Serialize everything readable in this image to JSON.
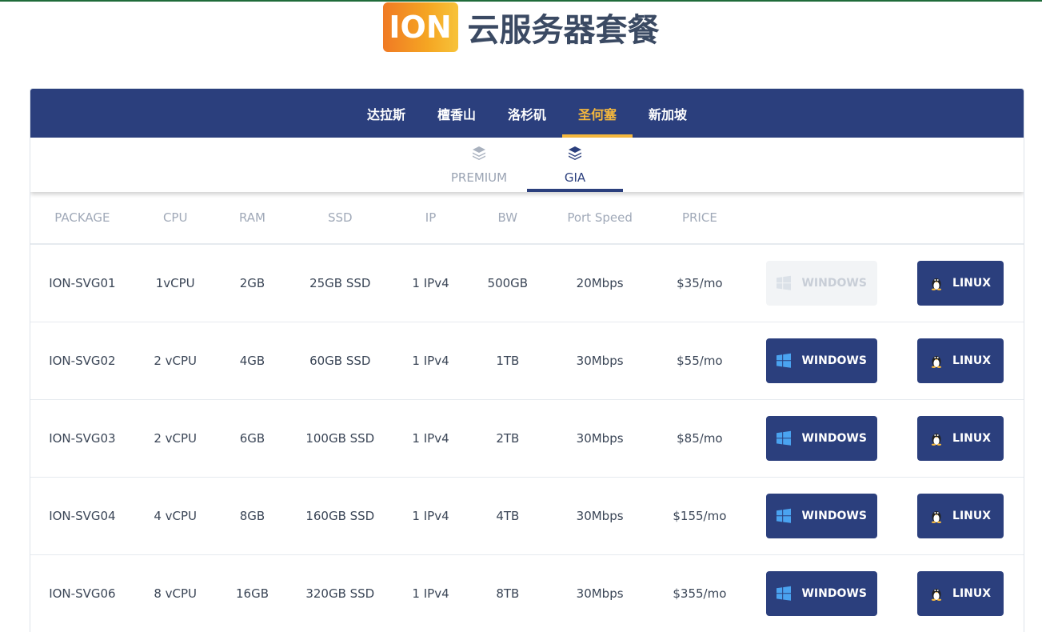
{
  "header": {
    "logo_text": "ION",
    "title": "云服务器套餐"
  },
  "locations": [
    {
      "label": "达拉斯",
      "active": false
    },
    {
      "label": "檀香山",
      "active": false
    },
    {
      "label": "洛杉矶",
      "active": false
    },
    {
      "label": "圣何塞",
      "active": true
    },
    {
      "label": "新加坡",
      "active": false
    }
  ],
  "plans": [
    {
      "label": "PREMIUM",
      "active": false
    },
    {
      "label": "GIA",
      "active": true
    }
  ],
  "table": {
    "headers": [
      "PACKAGE",
      "CPU",
      "RAM",
      "SSD",
      "IP",
      "BW",
      "Port Speed",
      "PRICE"
    ],
    "rows": [
      {
        "package": "ION-SVG01",
        "cpu": "1vCPU",
        "ram": "2GB",
        "ssd": "25GB SSD",
        "ip": "1 IPv4",
        "bw": "500GB",
        "port": "20Mbps",
        "price": "$35/mo",
        "windows_enabled": false
      },
      {
        "package": "ION-SVG02",
        "cpu": "2 vCPU",
        "ram": "4GB",
        "ssd": "60GB SSD",
        "ip": "1 IPv4",
        "bw": "1TB",
        "port": "30Mbps",
        "price": "$55/mo",
        "windows_enabled": true
      },
      {
        "package": "ION-SVG03",
        "cpu": "2 vCPU",
        "ram": "6GB",
        "ssd": "100GB SSD",
        "ip": "1 IPv4",
        "bw": "2TB",
        "port": "30Mbps",
        "price": "$85/mo",
        "windows_enabled": true
      },
      {
        "package": "ION-SVG04",
        "cpu": "4 vCPU",
        "ram": "8GB",
        "ssd": "160GB SSD",
        "ip": "1 IPv4",
        "bw": "4TB",
        "port": "30Mbps",
        "price": "$155/mo",
        "windows_enabled": true
      },
      {
        "package": "ION-SVG06",
        "cpu": "8 vCPU",
        "ram": "16GB",
        "ssd": "320GB SSD",
        "ip": "1 IPv4",
        "bw": "8TB",
        "port": "30Mbps",
        "price": "$355/mo",
        "windows_enabled": true
      }
    ]
  },
  "buttons": {
    "windows_label": "WINDOWS",
    "linux_label": "LINUX",
    "windows_icon": "windows-icon",
    "linux_icon": "linux-tux-icon"
  },
  "colors": {
    "navy": "#2b3f7d",
    "accent": "#f5b83d"
  }
}
